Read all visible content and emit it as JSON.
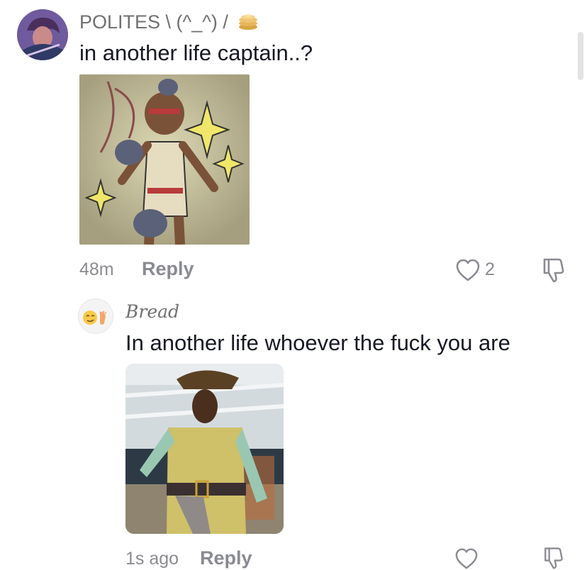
{
  "comments": [
    {
      "username": "POLITES \\ (^_^) /",
      "text": "in another life captain..?",
      "time": "48m",
      "reply_label": "Reply",
      "like_count": "2",
      "image_alt": "Drawing of a character with a headband holding cats, surrounded by yellow sparkles",
      "badge_icon": "pancakes-emoji"
    },
    {
      "username": "Bread",
      "avatar_emoji": "😏🦶",
      "text": "In another life whoever the fuck you are",
      "time": "1s ago",
      "reply_label": "Reply",
      "image_alt": "Photo of a person in a pirate costume with a tricorn hat"
    }
  ],
  "icons": {
    "like": "heart-outline-icon",
    "dislike": "thumbs-down-icon"
  },
  "colors": {
    "text": "#161823",
    "secondary": "#8a8b91",
    "username": "#707070"
  }
}
